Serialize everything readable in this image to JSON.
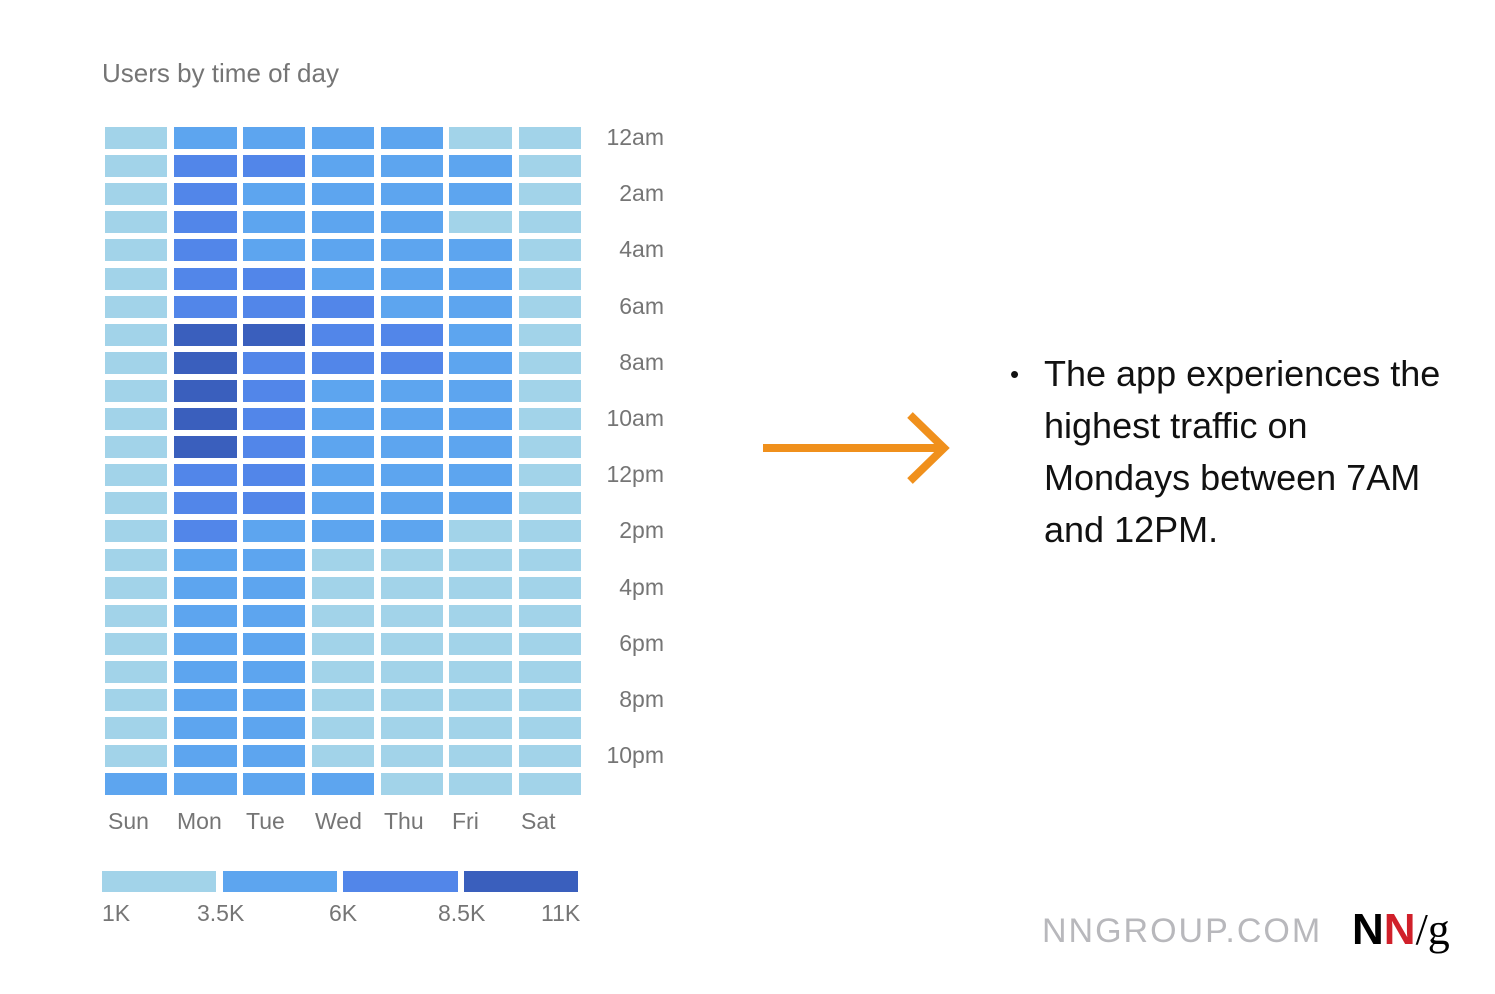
{
  "chart_data": {
    "type": "heatmap",
    "title": "Users by time of day",
    "x_categories": [
      "Sun",
      "Mon",
      "Tue",
      "Wed",
      "Thu",
      "Fri",
      "Sat"
    ],
    "y_categories": [
      "12am",
      "1am",
      "2am",
      "3am",
      "4am",
      "5am",
      "6am",
      "7am",
      "8am",
      "9am",
      "10am",
      "11am",
      "12pm",
      "1pm",
      "2pm",
      "3pm",
      "4pm",
      "5pm",
      "6pm",
      "7pm",
      "8pm",
      "9pm",
      "10pm",
      "11pm"
    ],
    "y_tick_labels": [
      "12am",
      "2am",
      "4am",
      "6am",
      "8am",
      "10am",
      "12pm",
      "2pm",
      "4pm",
      "6pm",
      "8pm",
      "10pm"
    ],
    "legend": {
      "bins": [
        "1K-3.5K",
        "3.5K-6K",
        "6K-8.5K",
        "8.5K-11K"
      ],
      "tick_labels": [
        "1K",
        "3.5K",
        "6K",
        "8.5K",
        "11K"
      ],
      "colors": [
        "#a2d3e9",
        "#5da5ef",
        "#5286e9",
        "#3a5fbd"
      ],
      "placement": "bottom"
    },
    "levels": [
      [
        0,
        1,
        1,
        1,
        1,
        0,
        0
      ],
      [
        0,
        2,
        2,
        1,
        1,
        1,
        0
      ],
      [
        0,
        2,
        1,
        1,
        1,
        1,
        0
      ],
      [
        0,
        2,
        1,
        1,
        1,
        0,
        0
      ],
      [
        0,
        2,
        1,
        1,
        1,
        1,
        0
      ],
      [
        0,
        2,
        2,
        1,
        1,
        1,
        0
      ],
      [
        0,
        2,
        2,
        2,
        1,
        1,
        0
      ],
      [
        0,
        3,
        3,
        2,
        2,
        1,
        0
      ],
      [
        0,
        3,
        2,
        2,
        2,
        1,
        0
      ],
      [
        0,
        3,
        2,
        1,
        1,
        1,
        0
      ],
      [
        0,
        3,
        2,
        1,
        1,
        1,
        0
      ],
      [
        0,
        3,
        2,
        1,
        1,
        1,
        0
      ],
      [
        0,
        2,
        2,
        1,
        1,
        1,
        0
      ],
      [
        0,
        2,
        2,
        1,
        1,
        1,
        0
      ],
      [
        0,
        2,
        1,
        1,
        1,
        0,
        0
      ],
      [
        0,
        1,
        1,
        0,
        0,
        0,
        0
      ],
      [
        0,
        1,
        1,
        0,
        0,
        0,
        0
      ],
      [
        0,
        1,
        1,
        0,
        0,
        0,
        0
      ],
      [
        0,
        1,
        1,
        0,
        0,
        0,
        0
      ],
      [
        0,
        1,
        1,
        0,
        0,
        0,
        0
      ],
      [
        0,
        1,
        1,
        0,
        0,
        0,
        0
      ],
      [
        0,
        1,
        1,
        0,
        0,
        0,
        0
      ],
      [
        0,
        1,
        1,
        0,
        0,
        0,
        0
      ],
      [
        1,
        1,
        1,
        1,
        0,
        0,
        0
      ]
    ]
  },
  "insight": {
    "bullet": "•",
    "text": "The app experiences the highest traffic on Mondays between 7AM and 12PM."
  },
  "arrow_color": "#f0901c",
  "footer": {
    "site": "NNGROUP.COM",
    "logo_n1": "N",
    "logo_n2": "N",
    "logo_slash": "/",
    "logo_g": "g"
  }
}
